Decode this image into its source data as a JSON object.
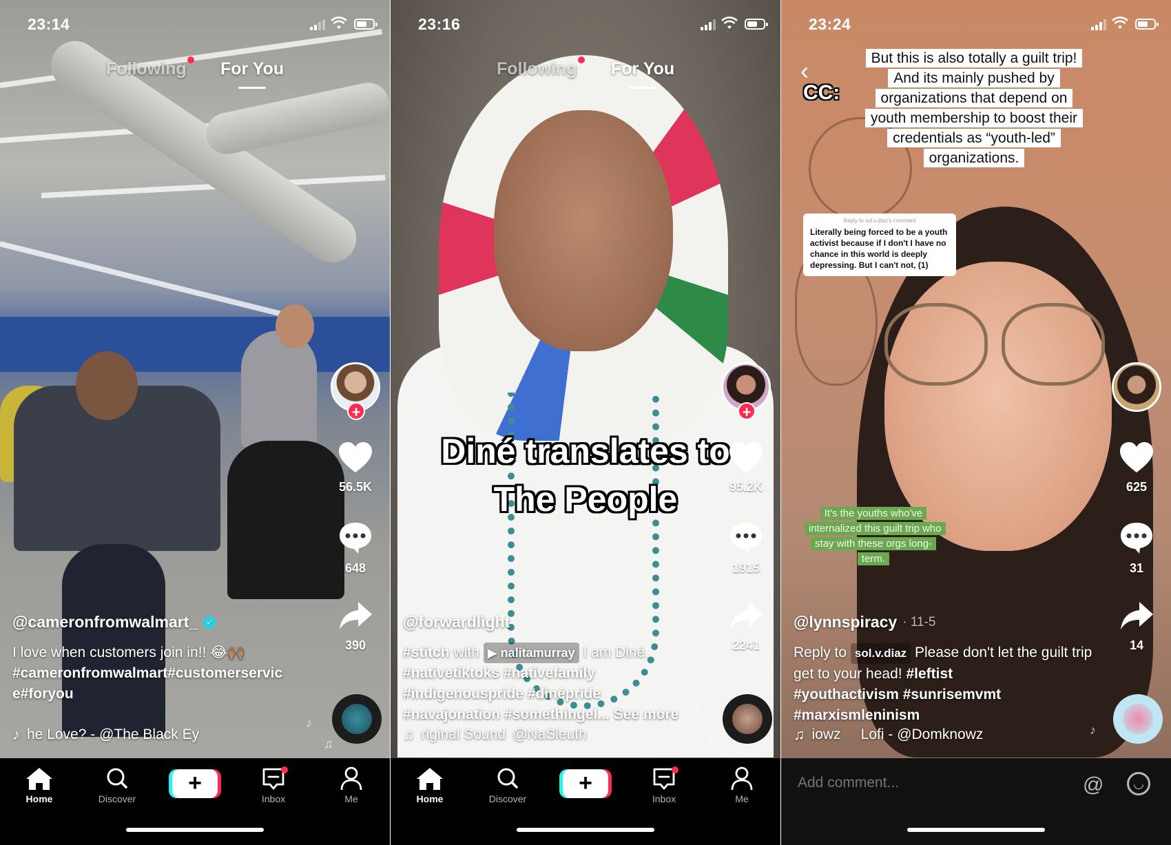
{
  "colors": {
    "accent": "#fe2c55",
    "cyan": "#25f4ee",
    "verified": "#20d5ec",
    "overlay_green": "#6aa94f"
  },
  "phones": [
    {
      "time": "23:14",
      "tabs": {
        "following": "Following",
        "for_you": "For You"
      },
      "likes": "56.5K",
      "comments": "648",
      "shares": "390",
      "username": "@cameronfromwalmart_",
      "verified": true,
      "description_text": "I love when customers join in!! 😂🙌🏽",
      "description_tags": "#cameronfromwalmart#customerservic e#foryou",
      "sound": "he Love? - @The Black Ey",
      "nav": {
        "home": "Home",
        "discover": "Discover",
        "create": "+",
        "inbox": "Inbox",
        "me": "Me"
      }
    },
    {
      "time": "23:16",
      "tabs": {
        "following": "Following",
        "for_you": "For You"
      },
      "overlay_line1": "Diné translates to",
      "overlay_line2": "The People",
      "likes": "95.2K",
      "comments": "1915",
      "shares": "2241",
      "username": "@forwardlight",
      "stitch_tag": "#stitch",
      "stitch_with": "with",
      "stitch_user": "▶ nalitamurray",
      "stitch_text": "I am Diné.",
      "tags_line1": "#nativetiktoks #nativefamily",
      "tags_line2": "#indigenouspride #dinépride",
      "tags_line3": "#navajonation #somethingel...",
      "see_more": "See more",
      "sound": "riginal Sound",
      "sound_author": "@NaSleuth",
      "nav": {
        "home": "Home",
        "discover": "Discover",
        "create": "+",
        "inbox": "Inbox",
        "me": "Me"
      }
    },
    {
      "time": "23:24",
      "cc_label": "CC:",
      "overlay_text": "But this is also totally a guilt trip! And its mainly pushed by organizations that depend on youth membership to boost their credentials as “youth-led” organizations.",
      "reply_card_head": "Reply to sol.v.diaz's comment",
      "reply_card_body": "Literally being forced to be a youth activist because if I don't I have no chance in this world is deeply depressing. But I can't not, (1)",
      "green_overlay": "It's the youths who've internalized this guilt trip who stay with these orgs long-term.",
      "likes": "625",
      "comments": "31",
      "shares": "14",
      "username": "@lynnspiracy",
      "date": "· 11-5",
      "reply_prefix": "Reply to",
      "reply_user": "sol.v.diaz",
      "reply_text": "Please don't let the guilt trip get to your head!",
      "tags_inline": "#leftist",
      "tags_line1": "#youthactivism #sunrisemvmt",
      "tags_line2": "#marxismleninism",
      "sound": "iowz     Lofi - @Domknowz",
      "comment_placeholder": "Add comment...",
      "at_symbol": "@"
    }
  ]
}
